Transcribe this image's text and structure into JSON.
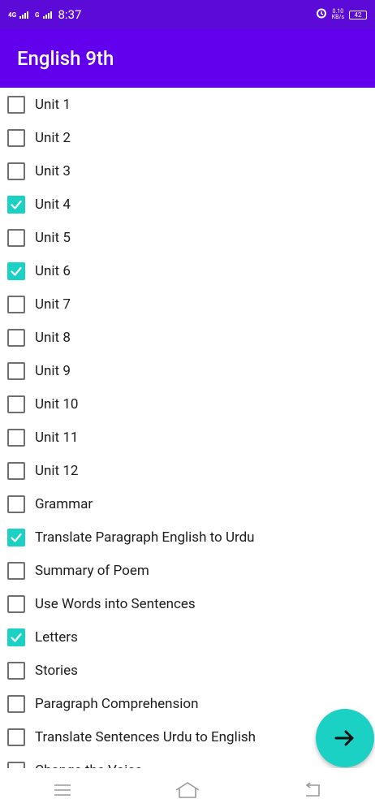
{
  "status": {
    "network_1": "4G",
    "network_2": "G",
    "time": "8:37",
    "speed_value": "0.10",
    "speed_unit": "KB/s",
    "battery": "42"
  },
  "app_bar": {
    "title": "English 9th"
  },
  "items": [
    {
      "label": "Unit 1",
      "checked": false
    },
    {
      "label": "Unit 2",
      "checked": false
    },
    {
      "label": "Unit 3",
      "checked": false
    },
    {
      "label": "Unit 4",
      "checked": true
    },
    {
      "label": "Unit 5",
      "checked": false
    },
    {
      "label": "Unit 6",
      "checked": true
    },
    {
      "label": "Unit 7",
      "checked": false
    },
    {
      "label": "Unit 8",
      "checked": false
    },
    {
      "label": "Unit 9",
      "checked": false
    },
    {
      "label": "Unit 10",
      "checked": false
    },
    {
      "label": "Unit 11",
      "checked": false
    },
    {
      "label": "Unit 12",
      "checked": false
    },
    {
      "label": "Grammar",
      "checked": false
    },
    {
      "label": "Translate Paragraph English to Urdu",
      "checked": true
    },
    {
      "label": "Summary of Poem",
      "checked": false
    },
    {
      "label": "Use Words into Sentences",
      "checked": false
    },
    {
      "label": "Letters",
      "checked": true
    },
    {
      "label": "Stories",
      "checked": false
    },
    {
      "label": "Paragraph Comprehension",
      "checked": false
    },
    {
      "label": "Translate Sentences Urdu to English",
      "checked": false
    },
    {
      "label": "Change the Voice",
      "checked": false
    }
  ],
  "fab": {
    "icon": "arrow-right-icon"
  },
  "nav": {
    "menu_icon": "menu-icon",
    "home_icon": "home-icon",
    "back_icon": "back-icon"
  },
  "colors": {
    "status_bar": "#5b0ad8",
    "app_bar": "#6200ee",
    "accent": "#1bd1c3"
  }
}
